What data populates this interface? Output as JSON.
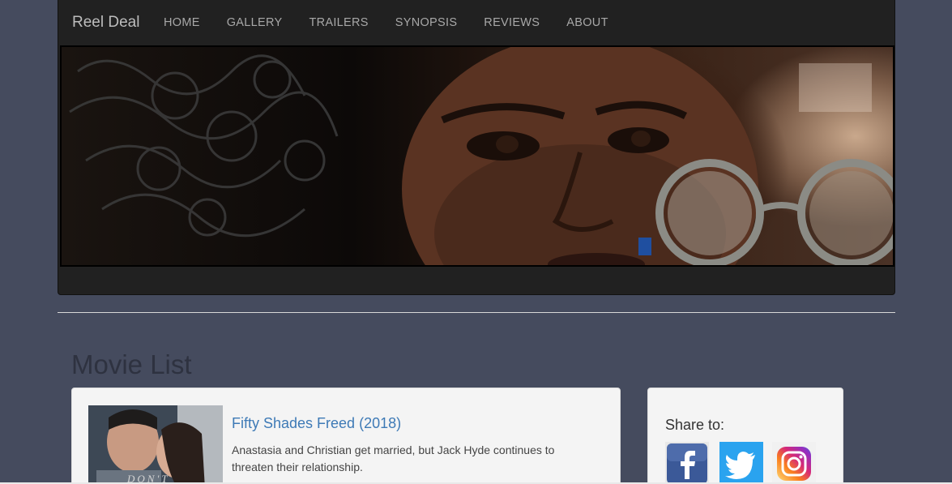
{
  "navbar": {
    "brand": "Reel Deal",
    "links": [
      "HOME",
      "GALLERY",
      "TRAILERS",
      "SYNOPSIS",
      "REVIEWS",
      "ABOUT"
    ]
  },
  "main": {
    "section_title": "Movie List",
    "movies": [
      {
        "title": "Fifty Shades Freed (2018)",
        "description": "Anastasia and Christian get married, but Jack Hyde continues to threaten their relationship.",
        "poster_text": "DON'T"
      }
    ]
  },
  "share": {
    "title": "Share to:",
    "icons": [
      "facebook-icon",
      "twitter-icon",
      "instagram-icon"
    ]
  },
  "colors": {
    "background": "#454b5e",
    "header": "#212121",
    "link": "#3e7ab6",
    "facebook": "#3b5998",
    "twitter": "#1da1f2"
  }
}
